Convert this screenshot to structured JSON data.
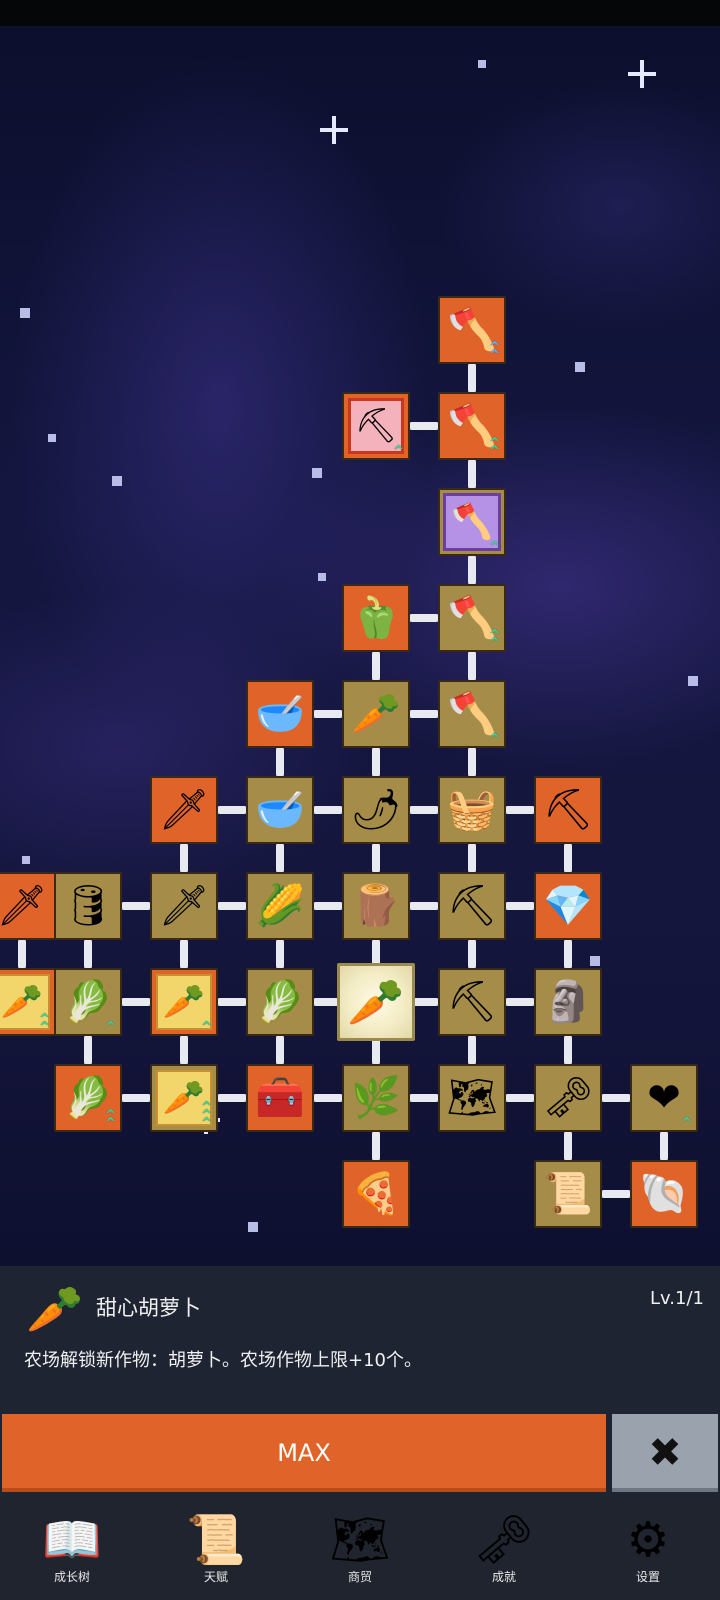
{
  "tree": {
    "nodes": [
      {
        "id": "shovel-top",
        "icon": "🪓",
        "label": "shovel",
        "style": "orange",
        "up": "blue",
        "col": 4,
        "row": 0
      },
      {
        "id": "shovel-pink",
        "icon": "⛏",
        "label": "shovel",
        "style": "pink",
        "up": "green1",
        "col": 3,
        "row": 1
      },
      {
        "id": "shovel-r1",
        "icon": "🪓",
        "label": "shovel",
        "style": "orange",
        "up": "green2",
        "col": 4,
        "row": 1
      },
      {
        "id": "shovel-purple",
        "icon": "🪓",
        "label": "shovel",
        "style": "purple",
        "up": "green1",
        "col": 4,
        "row": 2
      },
      {
        "id": "pepper",
        "icon": "🫑",
        "label": "pepper",
        "style": "orange",
        "up": "",
        "col": 3,
        "row": 3
      },
      {
        "id": "shovel-r3",
        "icon": "🪓",
        "label": "shovel",
        "style": "tan",
        "up": "green2",
        "col": 4,
        "row": 3
      },
      {
        "id": "bowl-top",
        "icon": "🥣",
        "label": "bowl",
        "style": "orange",
        "up": "",
        "col": 2,
        "row": 4
      },
      {
        "id": "radish",
        "icon": "🥕",
        "label": "radish",
        "style": "tan",
        "up": "",
        "col": 3,
        "row": 4
      },
      {
        "id": "shovel-r4",
        "icon": "🪓",
        "label": "shovel",
        "style": "tan",
        "up": "green1",
        "col": 4,
        "row": 4
      },
      {
        "id": "sword-gold",
        "icon": "🗡",
        "label": "sword",
        "style": "orange",
        "up": "",
        "col": 1,
        "row": 5
      },
      {
        "id": "bowl-mid",
        "icon": "🥣",
        "label": "bowl",
        "style": "tan",
        "up": "",
        "col": 2,
        "row": 5
      },
      {
        "id": "chili",
        "icon": "🌶",
        "label": "chili",
        "style": "tan",
        "up": "",
        "col": 3,
        "row": 5
      },
      {
        "id": "basket",
        "icon": "🧺",
        "label": "basket",
        "style": "tan",
        "up": "",
        "col": 4,
        "row": 5
      },
      {
        "id": "pickaxe-gold",
        "icon": "⛏",
        "label": "pickaxe",
        "style": "orange",
        "up": "",
        "col": 5,
        "row": 5
      },
      {
        "id": "sword-gray",
        "icon": "🗡",
        "label": "sword",
        "style": "orange",
        "up": "",
        "col": 0,
        "row": 6
      },
      {
        "id": "barrel",
        "icon": "🛢",
        "label": "barrel",
        "style": "tan",
        "up": "",
        "col": 1,
        "row": 6
      },
      {
        "id": "sword-tan",
        "icon": "🗡",
        "label": "sword",
        "style": "tan",
        "up": "",
        "col": 2,
        "row": 6
      },
      {
        "id": "corn",
        "icon": "🌽",
        "label": "corn",
        "style": "tan",
        "up": "",
        "col": 3,
        "row": 6
      },
      {
        "id": "stick",
        "icon": "🪵",
        "label": "stick",
        "style": "tan",
        "up": "",
        "col": 4,
        "row": 6
      },
      {
        "id": "pickaxe-1",
        "icon": "⛏",
        "label": "pickaxe",
        "style": "tan",
        "up": "",
        "col": 5,
        "row": 6
      },
      {
        "id": "crystal",
        "icon": "💎",
        "label": "crystal",
        "style": "orange",
        "up": "",
        "col": 6,
        "row": 6
      },
      {
        "id": "carrot-a",
        "icon": "🥕",
        "label": "carrot",
        "style": "yellow",
        "up": "green2",
        "col": 0,
        "row": 7
      },
      {
        "id": "cabbage-a",
        "icon": "🥬",
        "label": "cabbage",
        "style": "tan",
        "up": "green1",
        "col": 1,
        "row": 7
      },
      {
        "id": "carrot-b",
        "icon": "🥕",
        "label": "carrot",
        "style": "yellow",
        "up": "green1",
        "col": 2,
        "row": 7
      },
      {
        "id": "cabbage-b",
        "icon": "🥬",
        "label": "cabbage",
        "style": "tan",
        "up": "",
        "col": 3,
        "row": 7
      },
      {
        "id": "carrot-selected",
        "icon": "🥕",
        "label": "carrot",
        "style": "selected",
        "up": "",
        "col": 4,
        "row": 7
      },
      {
        "id": "pickaxe-2",
        "icon": "⛏",
        "label": "pickaxe",
        "style": "tan",
        "up": "",
        "col": 5,
        "row": 7
      },
      {
        "id": "statue",
        "icon": "🗿",
        "label": "statue",
        "style": "tan",
        "up": "",
        "col": 6,
        "row": 7
      },
      {
        "id": "cabbage-c",
        "icon": "🥬",
        "label": "cabbage",
        "style": "orange",
        "up": "green2",
        "col": 0,
        "row": 8
      },
      {
        "id": "carrot-c",
        "icon": "🥕",
        "label": "carrot",
        "style": "tan-yellow",
        "up": "green3",
        "col": 1,
        "row": 8
      },
      {
        "id": "chest",
        "icon": "🧰",
        "label": "chest",
        "style": "orange",
        "up": "",
        "col": 2,
        "row": 8
      },
      {
        "id": "leek",
        "icon": "🌿",
        "label": "leek",
        "style": "tan",
        "up": "",
        "col": 3,
        "row": 8
      },
      {
        "id": "map",
        "icon": "🗺",
        "label": "map",
        "style": "tan",
        "up": "",
        "col": 4,
        "row": 8
      },
      {
        "id": "key",
        "icon": "🗝",
        "label": "key",
        "style": "tan",
        "up": "",
        "col": 5,
        "row": 8
      },
      {
        "id": "heart",
        "icon": "❤",
        "label": "heart",
        "style": "tan",
        "up": "green1",
        "col": 6,
        "row": 8
      },
      {
        "id": "pizza",
        "icon": "🍕",
        "label": "pizza",
        "style": "orange",
        "up": "",
        "col": 3,
        "row": 9
      },
      {
        "id": "scroll",
        "icon": "📜",
        "label": "scroll",
        "style": "tan",
        "up": "",
        "col": 5,
        "row": 9
      },
      {
        "id": "fossil",
        "icon": "🐚",
        "label": "fossil",
        "style": "orange",
        "up": "",
        "col": 6,
        "row": 9
      }
    ]
  },
  "detail": {
    "icon": "🥕",
    "name": "甜心胡萝卜",
    "level": "Lv.1/1",
    "description": "农场解锁新作物：胡萝卜。农场作物上限+10个。"
  },
  "actions": {
    "max_label": "MAX",
    "close_icon": "✖"
  },
  "nav": {
    "items": [
      {
        "label": "成长树",
        "icon": "📖"
      },
      {
        "label": "天赋",
        "icon": "📜"
      },
      {
        "label": "商贸",
        "icon": "🗺"
      },
      {
        "label": "成就",
        "icon": "🗝"
      },
      {
        "label": "设置",
        "icon": "⚙"
      }
    ]
  }
}
